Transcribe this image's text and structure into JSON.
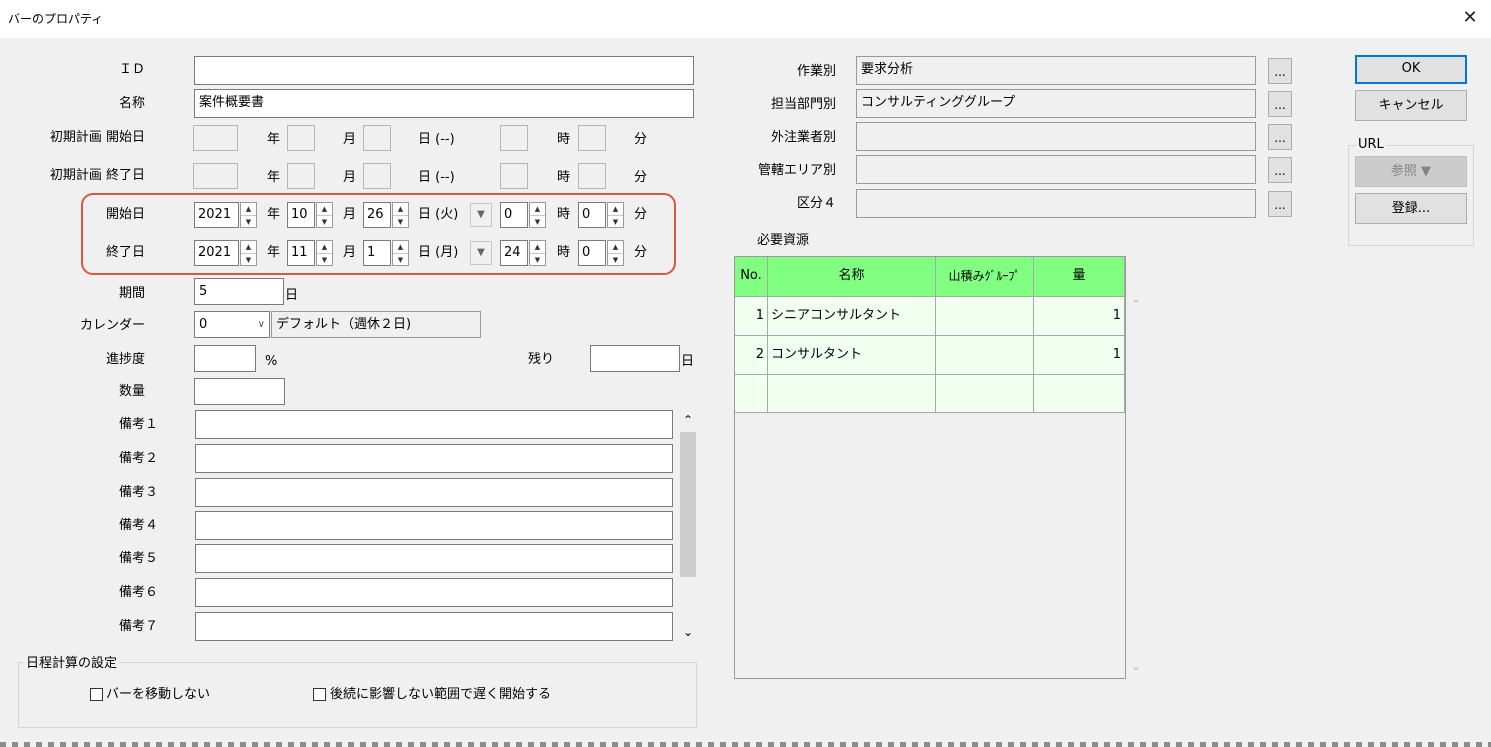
{
  "window": {
    "title": "バーのプロパティ",
    "close_glyph": "✕"
  },
  "left": {
    "id_label": "ＩＤ",
    "id_value": "",
    "name_label": "名称",
    "name_value": "案件概要書",
    "plan_start_label": "初期計画 開始日",
    "plan_end_label": "初期計画 終了日",
    "plan_units": {
      "year": "年",
      "month": "月",
      "day": "日 (--)",
      "hour": "時",
      "minute": "分"
    },
    "start_label": "開始日",
    "end_label": "終了日",
    "start": {
      "year": "2021",
      "month": "10",
      "day": "26",
      "weekday": "日 (火)",
      "hour": "0",
      "minute": "0"
    },
    "end": {
      "year": "2021",
      "month": "11",
      "day": "1",
      "weekday": "日 (月)",
      "hour": "24",
      "minute": "0"
    },
    "units": {
      "year": "年",
      "month": "月",
      "hour": "時",
      "minute": "分"
    },
    "period_label": "期間",
    "period_value": "5",
    "period_unit": "日",
    "calendar_label": "カレンダー",
    "calendar_value": "0",
    "calendar_name": "デフォルト（週休２日)",
    "progress_label": "進捗度",
    "progress_value": "",
    "progress_unit": "%",
    "remaining_label": "残り",
    "remaining_value": "",
    "remaining_unit": "日",
    "quantity_label": "数量",
    "quantity_value": "",
    "notes": [
      {
        "label": "備考１",
        "value": ""
      },
      {
        "label": "備考２",
        "value": ""
      },
      {
        "label": "備考３",
        "value": ""
      },
      {
        "label": "備考４",
        "value": ""
      },
      {
        "label": "備考５",
        "value": ""
      },
      {
        "label": "備考６",
        "value": ""
      },
      {
        "label": "備考７",
        "value": ""
      }
    ],
    "schedule_group_label": "日程計算の設定",
    "checkbox_no_move": "バーを移動しない",
    "checkbox_late_start": "後続に影響しない範囲で遅く開始する"
  },
  "right": {
    "work_label": "作業別",
    "work_value": "要求分析",
    "dept_label": "担当部門別",
    "dept_value": "コンサルティンググループ",
    "vendor_label": "外注業者別",
    "vendor_value": "",
    "area_label": "管轄エリア別",
    "area_value": "",
    "class4_label": "区分４",
    "class4_value": "",
    "ellipsis": "...",
    "resources_label": "必要資源",
    "grid": {
      "headers": [
        "No.",
        "名称",
        "山積みｸﾞﾙｰﾌﾟ",
        "量"
      ],
      "rows": [
        {
          "no": "1",
          "name": "シニアコンサルタント",
          "group": "",
          "qty": "1"
        },
        {
          "no": "2",
          "name": "コンサルタント",
          "group": "",
          "qty": "1"
        },
        {
          "no": "",
          "name": "",
          "group": "",
          "qty": ""
        }
      ]
    }
  },
  "buttons": {
    "ok": "OK",
    "cancel": "キャンセル",
    "url_label": "URL",
    "browse": "参照 ▼",
    "register": "登録..."
  },
  "colors": {
    "grid_header": "#80ff80",
    "grid_body": "#f0fff0",
    "highlight_border": "#d9573f",
    "ok_border": "#0078d7"
  }
}
